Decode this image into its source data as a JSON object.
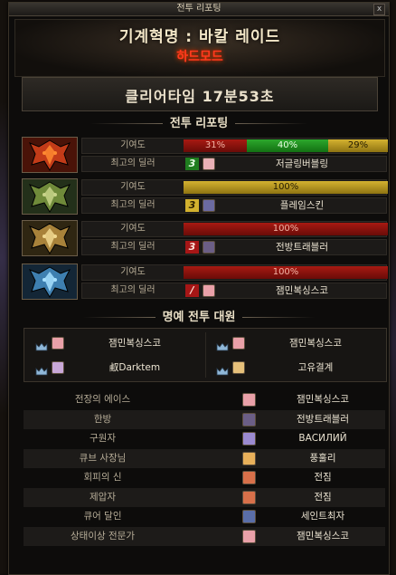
{
  "window": {
    "title": "전투 리포팅",
    "close_label": "x"
  },
  "header": {
    "raid_title": "기계혁명 : 바칼 레이드",
    "mode": "하드모드",
    "clear_time": "클리어타임 17분53초"
  },
  "battle_report": {
    "title": "전투 리포팅",
    "contribution_label": "기여도",
    "best_dealer_label": "최고의 딜러",
    "bosses": [
      {
        "icon": "red-dragon-boss-icon",
        "contribution": [
          {
            "label": "31%",
            "value": 31,
            "color": "red"
          },
          {
            "label": "40%",
            "value": 40,
            "color": "green"
          },
          {
            "label": "29%",
            "value": 29,
            "color": "yellow"
          }
        ],
        "rank": "3",
        "rank_color": "green",
        "avatar_color": "#e9b0b6",
        "dealer": "저글링버블링"
      },
      {
        "icon": "green-dragon-boss-icon",
        "contribution": [
          {
            "label": "100%",
            "value": 100,
            "color": "yellow"
          }
        ],
        "rank": "3",
        "rank_color": "yellow",
        "avatar_color": "#6b6aa0",
        "dealer": "플레임스킨"
      },
      {
        "icon": "gold-dragon-boss-icon",
        "contribution": [
          {
            "label": "100%",
            "value": 100,
            "color": "red"
          }
        ],
        "rank": "3",
        "rank_color": "red",
        "avatar_color": "#6b5e86",
        "dealer": "전방트래블러"
      },
      {
        "icon": "blue-dragon-boss-icon",
        "contribution": [
          {
            "label": "100%",
            "value": 100,
            "color": "red"
          }
        ],
        "rank": "/",
        "rank_color": "red",
        "avatar_color": "#e9a0a8",
        "dealer": "잼민복싱스코"
      }
    ]
  },
  "honor": {
    "title": "명예 전투 대원",
    "members": [
      {
        "avatar_color": "#e9a0a8",
        "name": "잼민복싱스코"
      },
      {
        "avatar_color": "#e9a0a8",
        "name": "잼민복싱스코"
      },
      {
        "avatar_color": "#c9a8d8",
        "name": "㕟Darktem"
      },
      {
        "avatar_color": "#e6c07a",
        "name": "고유결계"
      }
    ]
  },
  "awards": [
    {
      "title": "전장의 에이스",
      "avatar_color": "#e9a0a8",
      "name": "잼민복싱스코"
    },
    {
      "title": "한방",
      "avatar_color": "#6b5e86",
      "name": "전방트래블러"
    },
    {
      "title": "구원자",
      "avatar_color": "#9b8ad0",
      "name": "ВАСИЛИЙ"
    },
    {
      "title": "큐브 사장님",
      "avatar_color": "#e8b05a",
      "name": "풍훌리"
    },
    {
      "title": "회피의 신",
      "avatar_color": "#d8704a",
      "name": "전짐"
    },
    {
      "title": "제압자",
      "avatar_color": "#d8704a",
      "name": "전짐"
    },
    {
      "title": "큐어 달인",
      "avatar_color": "#5a6ea8",
      "name": "세인트최자"
    },
    {
      "title": "상태이상 전문가",
      "avatar_color": "#e9a0a8",
      "name": "잼민복싱스코"
    }
  ]
}
